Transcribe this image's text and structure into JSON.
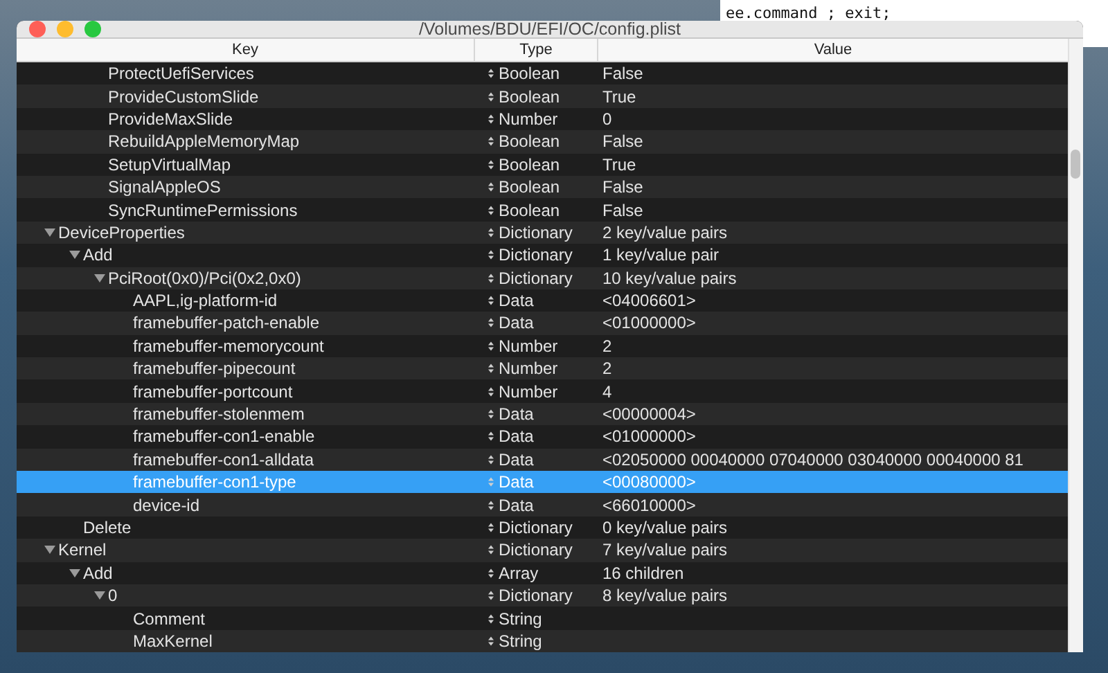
{
  "terminal": {
    "line": "ee.command ; exit;"
  },
  "window": {
    "title": "/Volumes/BDU/EFI/OC/config.plist"
  },
  "columns": [
    "Key",
    "Type",
    "Value"
  ],
  "tree": [
    {
      "children": [
        {
          "children": [
            {
              "key": "ProtectUefiServices",
              "type": "Boolean",
              "value": "False",
              "selected": false
            },
            {
              "key": "ProvideCustomSlide",
              "type": "Boolean",
              "value": "True",
              "selected": false
            },
            {
              "key": "ProvideMaxSlide",
              "type": "Number",
              "value": "0",
              "selected": false
            },
            {
              "key": "RebuildAppleMemoryMap",
              "type": "Boolean",
              "value": "False",
              "selected": false
            },
            {
              "key": "SetupVirtualMap",
              "type": "Boolean",
              "value": "True",
              "selected": false
            },
            {
              "key": "SignalAppleOS",
              "type": "Boolean",
              "value": "False",
              "selected": false
            },
            {
              "key": "SyncRuntimePermissions",
              "type": "Boolean",
              "value": "False",
              "selected": false
            }
          ]
        }
      ]
    },
    {
      "key": "DeviceProperties",
      "type": "Dictionary",
      "value": "2 key/value pairs",
      "selected": false,
      "expanded": true,
      "children": [
        {
          "key": "Add",
          "type": "Dictionary",
          "value": "1 key/value pair",
          "selected": false,
          "expanded": true,
          "children": [
            {
              "key": "PciRoot(0x0)/Pci(0x2,0x0)",
              "type": "Dictionary",
              "value": "10 key/value pairs",
              "selected": false,
              "expanded": true,
              "children": [
                {
                  "key": "AAPL,ig-platform-id",
                  "type": "Data",
                  "value": "<04006601>",
                  "selected": false
                },
                {
                  "key": "framebuffer-patch-enable",
                  "type": "Data",
                  "value": "<01000000>",
                  "selected": false
                },
                {
                  "key": "framebuffer-memorycount",
                  "type": "Number",
                  "value": "2",
                  "selected": false
                },
                {
                  "key": "framebuffer-pipecount",
                  "type": "Number",
                  "value": "2",
                  "selected": false
                },
                {
                  "key": "framebuffer-portcount",
                  "type": "Number",
                  "value": "4",
                  "selected": false
                },
                {
                  "key": "framebuffer-stolenmem",
                  "type": "Data",
                  "value": "<00000004>",
                  "selected": false
                },
                {
                  "key": "framebuffer-con1-enable",
                  "type": "Data",
                  "value": "<01000000>",
                  "selected": false
                },
                {
                  "key": "framebuffer-con1-alldata",
                  "type": "Data",
                  "value": "<02050000 00040000 07040000 03040000 00040000 81",
                  "selected": false
                },
                {
                  "key": "framebuffer-con1-type",
                  "type": "Data",
                  "value": "<00080000>",
                  "selected": true
                },
                {
                  "key": "device-id",
                  "type": "Data",
                  "value": "<66010000>",
                  "selected": false
                }
              ]
            }
          ]
        },
        {
          "key": "Delete",
          "type": "Dictionary",
          "value": "0 key/value pairs",
          "selected": false
        }
      ]
    },
    {
      "key": "Kernel",
      "type": "Dictionary",
      "value": "7 key/value pairs",
      "selected": false,
      "expanded": true,
      "children": [
        {
          "key": "Add",
          "type": "Array",
          "value": "16 children",
          "selected": false,
          "expanded": true,
          "children": [
            {
              "key": "0",
              "type": "Dictionary",
              "value": "8 key/value pairs",
              "selected": false,
              "expanded": true,
              "children": [
                {
                  "key": "Comment",
                  "type": "String",
                  "selected": false
                },
                {
                  "key": "MaxKernel",
                  "type": "String",
                  "selected": false
                }
              ]
            }
          ]
        }
      ]
    }
  ]
}
